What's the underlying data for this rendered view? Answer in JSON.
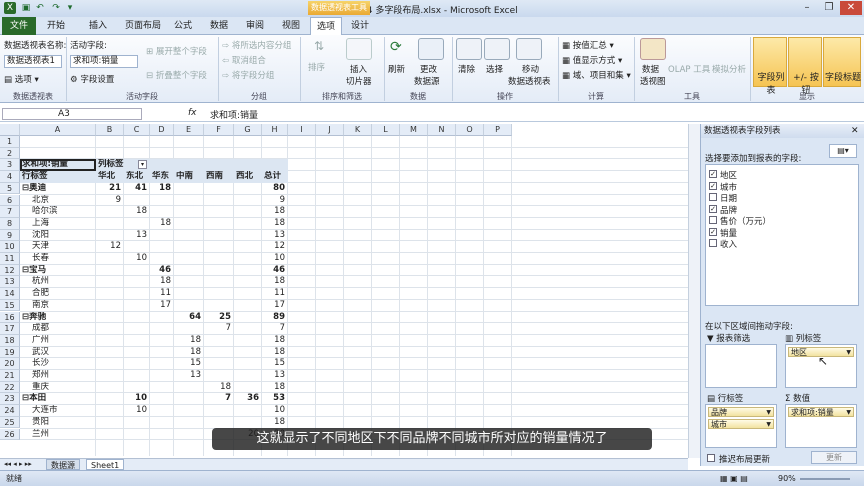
{
  "window": {
    "title": "02-04 多字段布局.xlsx - Microsoft Excel",
    "context_tool": "数据透视表工具"
  },
  "tabs": [
    "文件",
    "开始",
    "插入",
    "页面布局",
    "公式",
    "数据",
    "审阅",
    "视图",
    "选项",
    "设计"
  ],
  "active_tab": "选项",
  "ribbon": {
    "pivot": {
      "name_label": "数据透视表名称:",
      "name_value": "数据透视表1",
      "options": "选项",
      "group": "数据透视表"
    },
    "active_field": {
      "label": "活动字段:",
      "value": "求和项:销量",
      "settings": "字段设置",
      "expand": "展开整个字段",
      "collapse": "折叠整个字段",
      "group": "活动字段"
    },
    "grouping": {
      "group_sel": "将所选内容分组",
      "ungroup": "取消组合",
      "group_field": "将字段分组",
      "group": "分组"
    },
    "sort": {
      "sort": "排序",
      "insert_slicer": "插入",
      "slicer": "切片器",
      "group": "排序和筛选"
    },
    "data": {
      "refresh": "刷新",
      "change_source": "更改",
      "data_source": "数据源",
      "group": "数据"
    },
    "actions": {
      "clear": "清除",
      "select": "选择",
      "move": "移动",
      "move_pt": "数据透视表",
      "group": "操作"
    },
    "calc": {
      "summarize": "按值汇总",
      "show_as": "值显示方式",
      "fields_items": "域、项目和集",
      "group": "计算"
    },
    "tools": {
      "pivotchart": "数据",
      "pivotchart2": "透视图",
      "olap": "OLAP 工具",
      "whatif": "模拟分析",
      "group": "工具"
    },
    "show": {
      "fieldlist": "字段列表",
      "buttons": "+/- 按钮",
      "headers": "字段标题",
      "group": "显示"
    }
  },
  "formula_bar": {
    "cell": "A3",
    "fx": "fx",
    "value": "求和项:销量"
  },
  "columns": [
    "A",
    "B",
    "C",
    "D",
    "E",
    "F",
    "G",
    "H",
    "I",
    "J",
    "K",
    "L",
    "M",
    "N",
    "O",
    "P"
  ],
  "rows": [
    {
      "n": "1",
      "a": "",
      "cells": []
    },
    {
      "n": "2",
      "a": "",
      "cells": []
    },
    {
      "n": "3",
      "a": "求和项:销量",
      "b": "列标签",
      "cells": [],
      "header": true
    },
    {
      "n": "4",
      "a": "行标签",
      "cells": [
        "华北",
        "东北",
        "华东",
        "中南",
        "西南",
        "西北",
        "总计"
      ],
      "header": true
    },
    {
      "n": "5",
      "a": "⊟奥迪",
      "cells": [
        "21",
        "41",
        "18",
        "",
        "",
        "",
        "80"
      ],
      "bold": true
    },
    {
      "n": "6",
      "a": "北京",
      "cells": [
        "9",
        "",
        "",
        "",
        "",
        "",
        "9"
      ],
      "indent": true
    },
    {
      "n": "7",
      "a": "哈尔滨",
      "cells": [
        "",
        "18",
        "",
        "",
        "",
        "",
        "18"
      ],
      "indent": true
    },
    {
      "n": "8",
      "a": "上海",
      "cells": [
        "",
        "",
        "18",
        "",
        "",
        "",
        "18"
      ],
      "indent": true
    },
    {
      "n": "9",
      "a": "沈阳",
      "cells": [
        "",
        "13",
        "",
        "",
        "",
        "",
        "13"
      ],
      "indent": true
    },
    {
      "n": "10",
      "a": "天津",
      "cells": [
        "12",
        "",
        "",
        "",
        "",
        "",
        "12"
      ],
      "indent": true
    },
    {
      "n": "11",
      "a": "长春",
      "cells": [
        "",
        "10",
        "",
        "",
        "",
        "",
        "10"
      ],
      "indent": true
    },
    {
      "n": "12",
      "a": "⊟宝马",
      "cells": [
        "",
        "",
        "46",
        "",
        "",
        "",
        "46"
      ],
      "bold": true
    },
    {
      "n": "13",
      "a": "杭州",
      "cells": [
        "",
        "",
        "18",
        "",
        "",
        "",
        "18"
      ],
      "indent": true
    },
    {
      "n": "14",
      "a": "合肥",
      "cells": [
        "",
        "",
        "11",
        "",
        "",
        "",
        "11"
      ],
      "indent": true
    },
    {
      "n": "15",
      "a": "南京",
      "cells": [
        "",
        "",
        "17",
        "",
        "",
        "",
        "17"
      ],
      "indent": true
    },
    {
      "n": "16",
      "a": "⊟奔驰",
      "cells": [
        "",
        "",
        "",
        "64",
        "25",
        "",
        "89"
      ],
      "bold": true
    },
    {
      "n": "17",
      "a": "成都",
      "cells": [
        "",
        "",
        "",
        "",
        "7",
        "",
        "7"
      ],
      "indent": true
    },
    {
      "n": "18",
      "a": "广州",
      "cells": [
        "",
        "",
        "",
        "18",
        "",
        "",
        "18"
      ],
      "indent": true
    },
    {
      "n": "19",
      "a": "武汉",
      "cells": [
        "",
        "",
        "",
        "18",
        "",
        "",
        "18"
      ],
      "indent": true
    },
    {
      "n": "20",
      "a": "长沙",
      "cells": [
        "",
        "",
        "",
        "15",
        "",
        "",
        "15"
      ],
      "indent": true
    },
    {
      "n": "21",
      "a": "郑州",
      "cells": [
        "",
        "",
        "",
        "13",
        "",
        "",
        "13"
      ],
      "indent": true
    },
    {
      "n": "22",
      "a": "重庆",
      "cells": [
        "",
        "",
        "",
        "",
        "18",
        "",
        "18"
      ],
      "indent": true
    },
    {
      "n": "23",
      "a": "⊟本田",
      "cells": [
        "",
        "10",
        "",
        "",
        "7",
        "36",
        "53"
      ],
      "bold": true
    },
    {
      "n": "24",
      "a": "大连市",
      "cells": [
        "",
        "10",
        "",
        "",
        "",
        "",
        "10"
      ],
      "indent": true
    },
    {
      "n": "25",
      "a": "贵阳",
      "cells": [
        "",
        "",
        "",
        "",
        "",
        "",
        "18"
      ],
      "indent": true
    },
    {
      "n": "26",
      "a": "兰州",
      "cells": [
        "",
        "",
        "",
        "",
        "",
        "20",
        "20"
      ],
      "indent": true
    }
  ],
  "sheet_tabs": [
    "数据源",
    "Sheet1"
  ],
  "pane": {
    "title": "数据透视表字段列表",
    "choose_label": "选择要添加到报表的字段:",
    "fields": [
      {
        "name": "地区",
        "checked": true
      },
      {
        "name": "城市",
        "checked": true
      },
      {
        "name": "日期",
        "checked": false
      },
      {
        "name": "品牌",
        "checked": true
      },
      {
        "name": "售价（万元）",
        "checked": false
      },
      {
        "name": "销量",
        "checked": true
      },
      {
        "name": "收入",
        "checked": false
      }
    ],
    "drag_label": "在以下区域间拖动字段:",
    "report_filter": "报表筛选",
    "col_labels": "列标签",
    "col_items": [
      "地区"
    ],
    "row_labels": "行标签",
    "row_items": [
      "品牌",
      "城市"
    ],
    "values": "数值",
    "value_items": [
      "求和项:销量"
    ],
    "defer": "推迟布局更新",
    "update": "更新"
  },
  "status": {
    "ready": "就绪",
    "zoom": "90%"
  },
  "subtitle": "这就显示了不同地区下不同品牌不同城市所对应的销量情况了",
  "colors": {
    "file_tab": "#2a6a2a",
    "context": "#eaa934",
    "ribbon_bg": "#e4ecf7"
  }
}
